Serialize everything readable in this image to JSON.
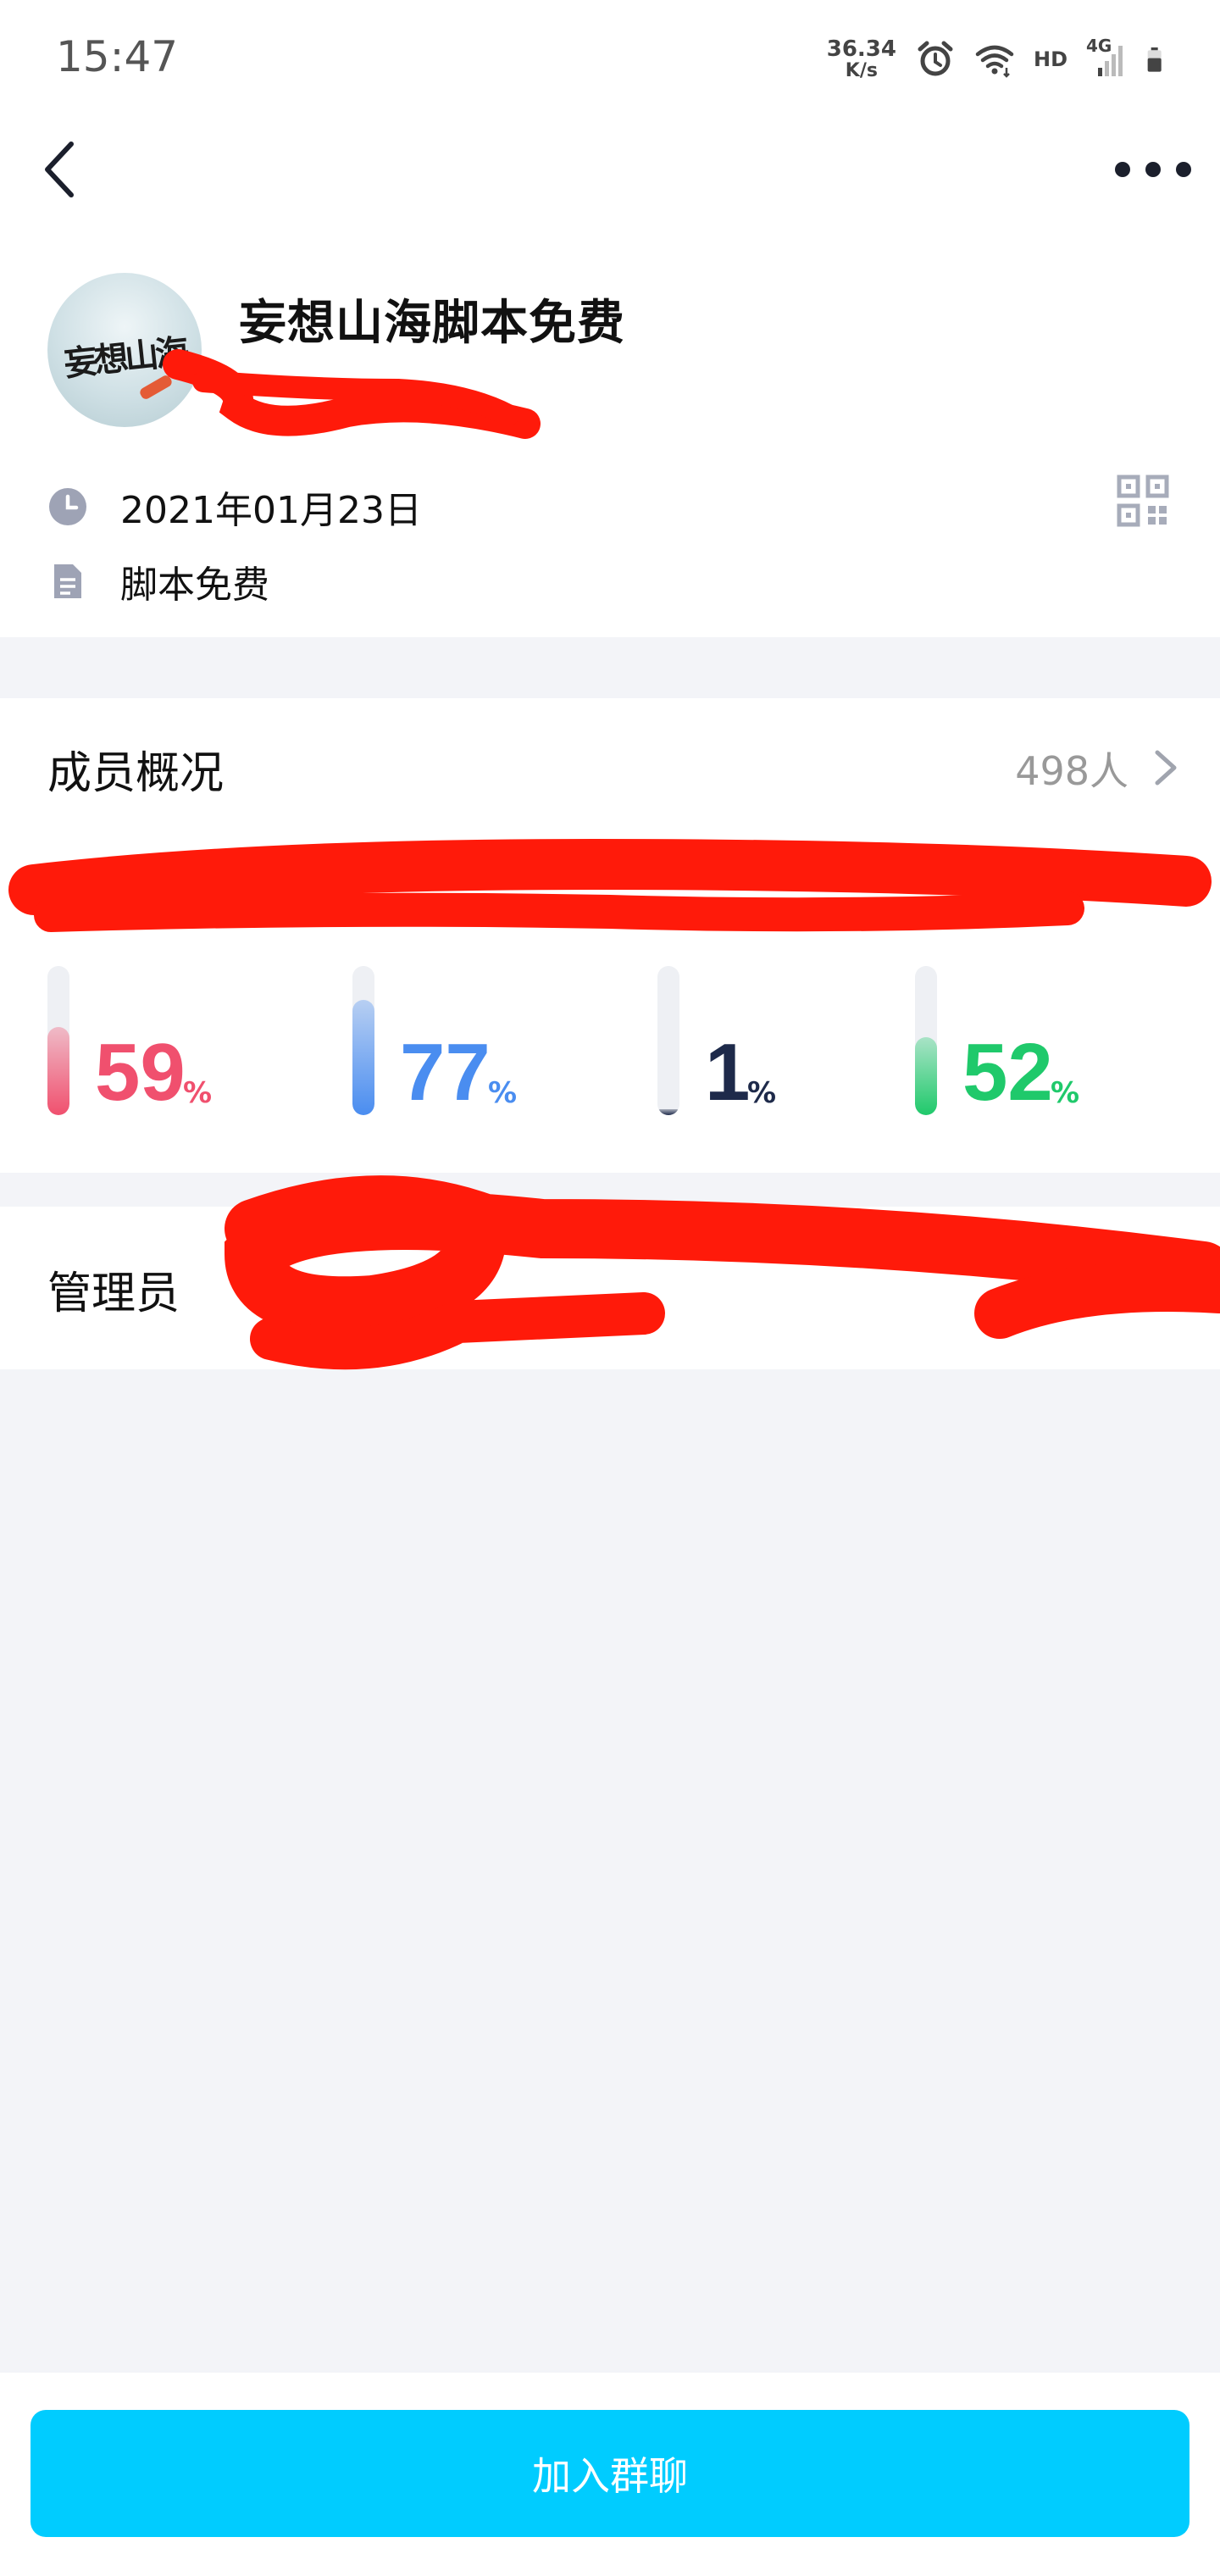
{
  "status_bar": {
    "time": "15:47",
    "net_speed_value": "36.34",
    "net_speed_unit": "K/s",
    "hd_label": "HD",
    "network_type": "4G",
    "icons": [
      "alarm-icon",
      "wifi-icon",
      "signal-icon",
      "battery-icon"
    ]
  },
  "header": {
    "back_icon": "chevron-left-icon",
    "more_icon": "more-dots-icon"
  },
  "group": {
    "name": "妄想山海脚本免费",
    "avatar_text": "妄想山海",
    "created_date": "2021年01月23日",
    "description": "脚本免费",
    "date_icon": "clock-icon",
    "description_icon": "document-icon",
    "qr_icon": "qr-code-icon"
  },
  "members": {
    "title": "成员概况",
    "count": "498人",
    "stats": [
      {
        "value": "59",
        "unit": "%",
        "color": "#f0506e",
        "fill": 0.59
      },
      {
        "value": "77",
        "unit": "%",
        "color": "#4a8df0",
        "fill": 0.77
      },
      {
        "value": "1",
        "unit": "%",
        "color": "#1e2a4a",
        "fill": 0.01
      },
      {
        "value": "52",
        "unit": "%",
        "color": "#1fc96b",
        "fill": 0.52
      }
    ]
  },
  "admins": {
    "title": "管理员"
  },
  "actions": {
    "join_label": "加入群聊"
  },
  "colors": {
    "accent": "#00ccff",
    "background": "#f3f4f8",
    "redaction": "#ff1a0a"
  }
}
